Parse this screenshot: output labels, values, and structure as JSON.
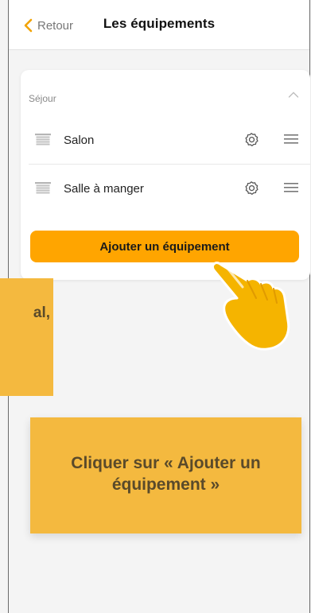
{
  "header": {
    "back_label": "Retour",
    "title": "Les équipements"
  },
  "section": {
    "room_label": "Séjour",
    "devices": [
      {
        "name": "Salon",
        "icon": "shutter-icon"
      },
      {
        "name": "Salle à manger",
        "icon": "shutter-icon"
      }
    ],
    "add_button_label": "Ajouter un équipement"
  },
  "callouts": {
    "left_fragment": "al,",
    "main": "Cliquer sur « Ajouter un équipement »"
  },
  "colors": {
    "accent": "#ffa500",
    "callout_bg": "#f4b93f",
    "callout_text": "#5a4a2a",
    "back_chevron": "#f2a300"
  }
}
